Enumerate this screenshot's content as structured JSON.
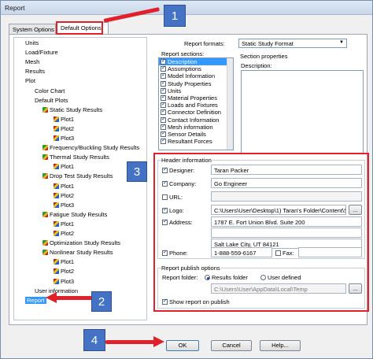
{
  "window": {
    "title": "Report"
  },
  "tabs": [
    {
      "label": "System Options"
    },
    {
      "label": "Default Options"
    }
  ],
  "tree": [
    {
      "label": "Units",
      "icon": ""
    },
    {
      "label": "Load/Fixture",
      "icon": ""
    },
    {
      "label": "Mesh",
      "icon": ""
    },
    {
      "label": "Results",
      "icon": ""
    },
    {
      "label": "Plot",
      "icon": ""
    },
    {
      "label": "Color Chart",
      "icon": ""
    },
    {
      "label": "Default Plots",
      "icon": ""
    },
    {
      "label": "Static Study Results",
      "icon": "study-icon"
    },
    {
      "label": "Plot1",
      "icon": "plot-icon"
    },
    {
      "label": "Plot2",
      "icon": "plot-icon"
    },
    {
      "label": "Plot3",
      "icon": "plot-icon"
    },
    {
      "label": "Frequency/Buckling Study Results",
      "icon": "study-icon"
    },
    {
      "label": "Thermal Study Results",
      "icon": "study-icon"
    },
    {
      "label": "Plot1",
      "icon": "plot-icon"
    },
    {
      "label": "Drop Test Study Results",
      "icon": "study-icon"
    },
    {
      "label": "Plot1",
      "icon": "plot-icon"
    },
    {
      "label": "Plot2",
      "icon": "plot-icon"
    },
    {
      "label": "Plot3",
      "icon": "plot-icon"
    },
    {
      "label": "Fatigue Study Results",
      "icon": "study-icon"
    },
    {
      "label": "Plot1",
      "icon": "plot-icon"
    },
    {
      "label": "Plot2",
      "icon": "plot-icon"
    },
    {
      "label": "Optimization Study Results",
      "icon": "study-icon"
    },
    {
      "label": "Nonlinear Study Results",
      "icon": "study-icon"
    },
    {
      "label": "Plot1",
      "icon": "plot-icon"
    },
    {
      "label": "Plot2",
      "icon": "plot-icon"
    },
    {
      "label": "Plot3",
      "icon": "plot-icon"
    },
    {
      "label": "User information",
      "icon": ""
    },
    {
      "label": "Report",
      "icon": "",
      "selected": true
    }
  ],
  "report": {
    "formats_label": "Report formats:",
    "format_value": "Static Study Format",
    "sections_label": "Report sections:",
    "sections": [
      {
        "label": "Description",
        "checked": true,
        "highlight": true
      },
      {
        "label": "Assumptions",
        "checked": true
      },
      {
        "label": "Model Information",
        "checked": true
      },
      {
        "label": "Study Properties",
        "checked": true
      },
      {
        "label": "Units",
        "checked": true
      },
      {
        "label": "Material Properties",
        "checked": true
      },
      {
        "label": "Loads and Fixtures",
        "checked": true
      },
      {
        "label": "Connector Definition",
        "checked": true
      },
      {
        "label": "Contact Information",
        "checked": true
      },
      {
        "label": "Mesh information",
        "checked": true
      },
      {
        "label": "Sensor Details",
        "checked": true
      },
      {
        "label": "Resultant Forces",
        "checked": true
      }
    ],
    "section_properties_label": "Section properties",
    "description_label": "Description:"
  },
  "header": {
    "group_label": "Header information",
    "designer": {
      "label": "Designer:",
      "checked": true,
      "value": "Taran Packer"
    },
    "company": {
      "label": "Company:",
      "checked": true,
      "value": "Go Engineer"
    },
    "url": {
      "label": "URL:",
      "checked": false,
      "value": ""
    },
    "logo": {
      "label": "Logo:",
      "checked": true,
      "value": "C:\\Users\\User\\Desktop\\1) Taran's Folder\\Content\\S("
    },
    "address": {
      "label": "Address:",
      "checked": true,
      "line1": "1787 E. Fort Union Blvd. Suite 200",
      "line2": "",
      "line3": "Salt Lake City, UT 84121"
    },
    "phone": {
      "label": "Phone:",
      "checked": true,
      "value": "1-888-559-6167"
    },
    "fax": {
      "label": "Fax:",
      "checked": false,
      "value": ""
    },
    "browse": "..."
  },
  "publish": {
    "group_label": "Report publish options",
    "folder_label": "Report folder:",
    "opt_results": "Results folder",
    "opt_user": "User defined",
    "folder_path": "C:\\Users\\User\\AppData\\Local\\Temp",
    "show_label": "Show report on publish",
    "show_checked": true
  },
  "buttons": {
    "ok": "OK",
    "cancel": "Cancel",
    "help": "Help..."
  },
  "callouts": {
    "one": "1",
    "two": "2",
    "three": "3",
    "four": "4"
  }
}
